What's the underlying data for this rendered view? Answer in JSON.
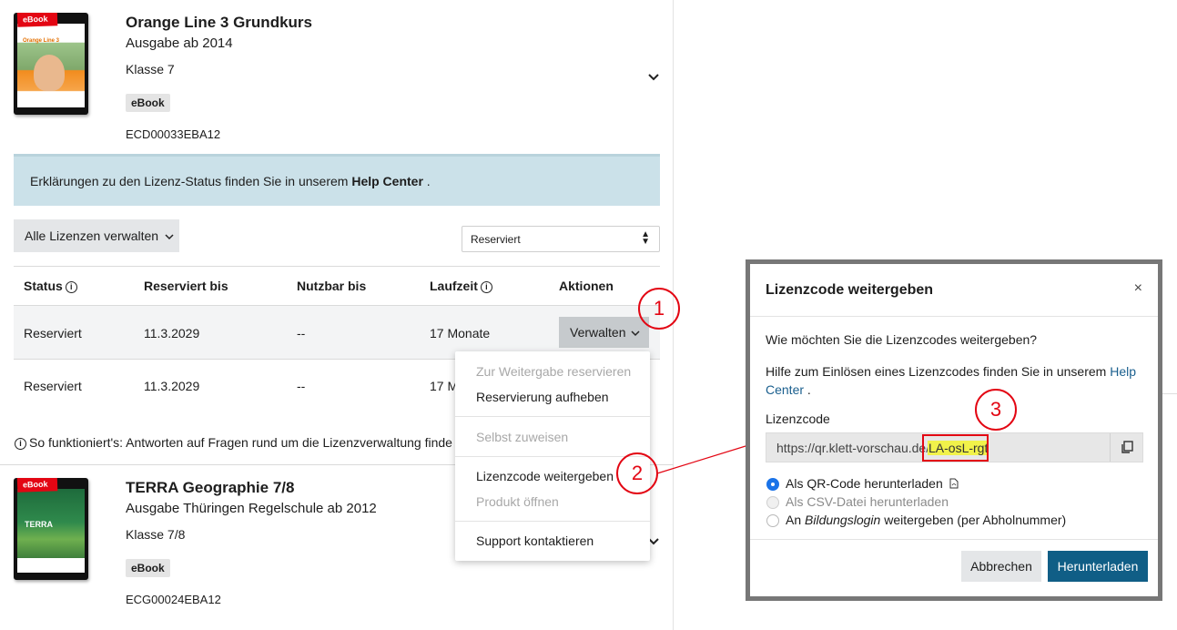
{
  "products": [
    {
      "cover_tag": "eBook",
      "cover_title": "Orange Line 3",
      "title": "Orange Line 3 Grundkurs",
      "edition": "Ausgabe ab 2014",
      "class": "Klasse 7",
      "badge": "eBook",
      "code": "ECD00033EBA12"
    },
    {
      "cover_tag": "eBook",
      "cover_title": "TERRA",
      "title": "TERRA Geographie 7/8",
      "edition": "Ausgabe Thüringen Regelschule ab 2012",
      "class": "Klasse 7/8",
      "badge": "eBook",
      "code": "ECG00024EBA12"
    }
  ],
  "info_box": {
    "text": "Erklärungen zu den Lizenz-Status finden Sie in unserem ",
    "link": "Help Center",
    "suffix": " ."
  },
  "manage_all_label": "Alle Lizenzen verwalten",
  "filter_select": {
    "value": "Reserviert"
  },
  "table": {
    "headers": [
      "Status",
      "Reserviert bis",
      "Nutzbar bis",
      "Laufzeit",
      "Aktionen"
    ],
    "rows": [
      {
        "status": "Reserviert",
        "reserved_until": "11.3.2029",
        "usable_until": "--",
        "duration": "17 Monate",
        "action": "Verwalten"
      },
      {
        "status": "Reserviert",
        "reserved_until": "11.3.2029",
        "usable_until": "--",
        "duration": "17 M"
      }
    ]
  },
  "howto_text": "So funktioniert's: Antworten auf Fragen rund um die Lizenzverwaltung finde",
  "dropdown_menu": {
    "items": [
      {
        "label": "Zur Weitergabe reservieren",
        "disabled": true
      },
      {
        "label": "Reservierung aufheben",
        "disabled": false
      },
      {
        "label": "Selbst zuweisen",
        "disabled": true
      },
      {
        "label": "Lizenzcode weitergeben",
        "disabled": false
      },
      {
        "label": "Produkt öffnen",
        "disabled": true
      },
      {
        "label": "Support kontaktieren",
        "disabled": false
      }
    ]
  },
  "annotations": [
    "1",
    "2",
    "3"
  ],
  "modal": {
    "title": "Lizenzcode weitergeben",
    "close": "×",
    "question": "Wie möchten Sie die Lizenzcodes weitergeben?",
    "help_text": "Hilfe zum Einlösen eines Lizenzcodes finden Sie in unserem ",
    "help_link_1": "Help",
    "help_link_2": "Center",
    "help_suffix": " .",
    "field_label": "Lizenzcode",
    "code_prefix": "https://qr.klett-vorschau.de/",
    "code_value": "LA-osL-rgt",
    "options": [
      {
        "label": "Als QR-Code herunterladen",
        "checked": true,
        "disabled": false
      },
      {
        "label": "Als CSV-Datei herunterladen",
        "checked": false,
        "disabled": true
      },
      {
        "label_pre": "An ",
        "label_em": "Bildungslogin",
        "label_post": " weitergeben (per Abholnummer)",
        "checked": false,
        "disabled": false
      }
    ],
    "cancel_label": "Abbrechen",
    "download_label": "Herunterladen"
  },
  "colors": {
    "accent_blue": "#105e86",
    "info_bg": "#cbe1e9",
    "annotation_red": "#e30613",
    "highlight_yellow": "#f1f24a"
  }
}
